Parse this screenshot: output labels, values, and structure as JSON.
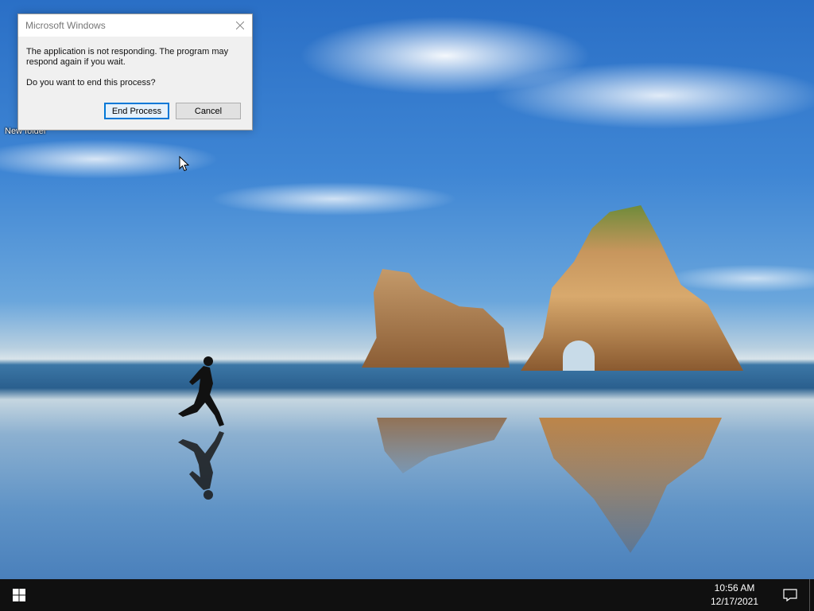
{
  "desktop": {
    "icons": [
      {
        "label": "New folder"
      }
    ]
  },
  "dialog": {
    "title": "Microsoft Windows",
    "message": "The application is not responding. The program may respond again if you wait.",
    "question": "Do you want to end this process?",
    "buttons": {
      "end_process": "End Process",
      "cancel": "Cancel"
    },
    "close_icon": "close-icon"
  },
  "taskbar": {
    "start_icon": "windows-logo-icon",
    "clock": {
      "time": "10:56 AM",
      "date": "12/17/2021"
    },
    "notification_icon": "action-center-icon"
  },
  "colors": {
    "taskbar_bg": "#101010",
    "accent": "#0078d7",
    "dialog_bg": "#f0f0f0"
  }
}
